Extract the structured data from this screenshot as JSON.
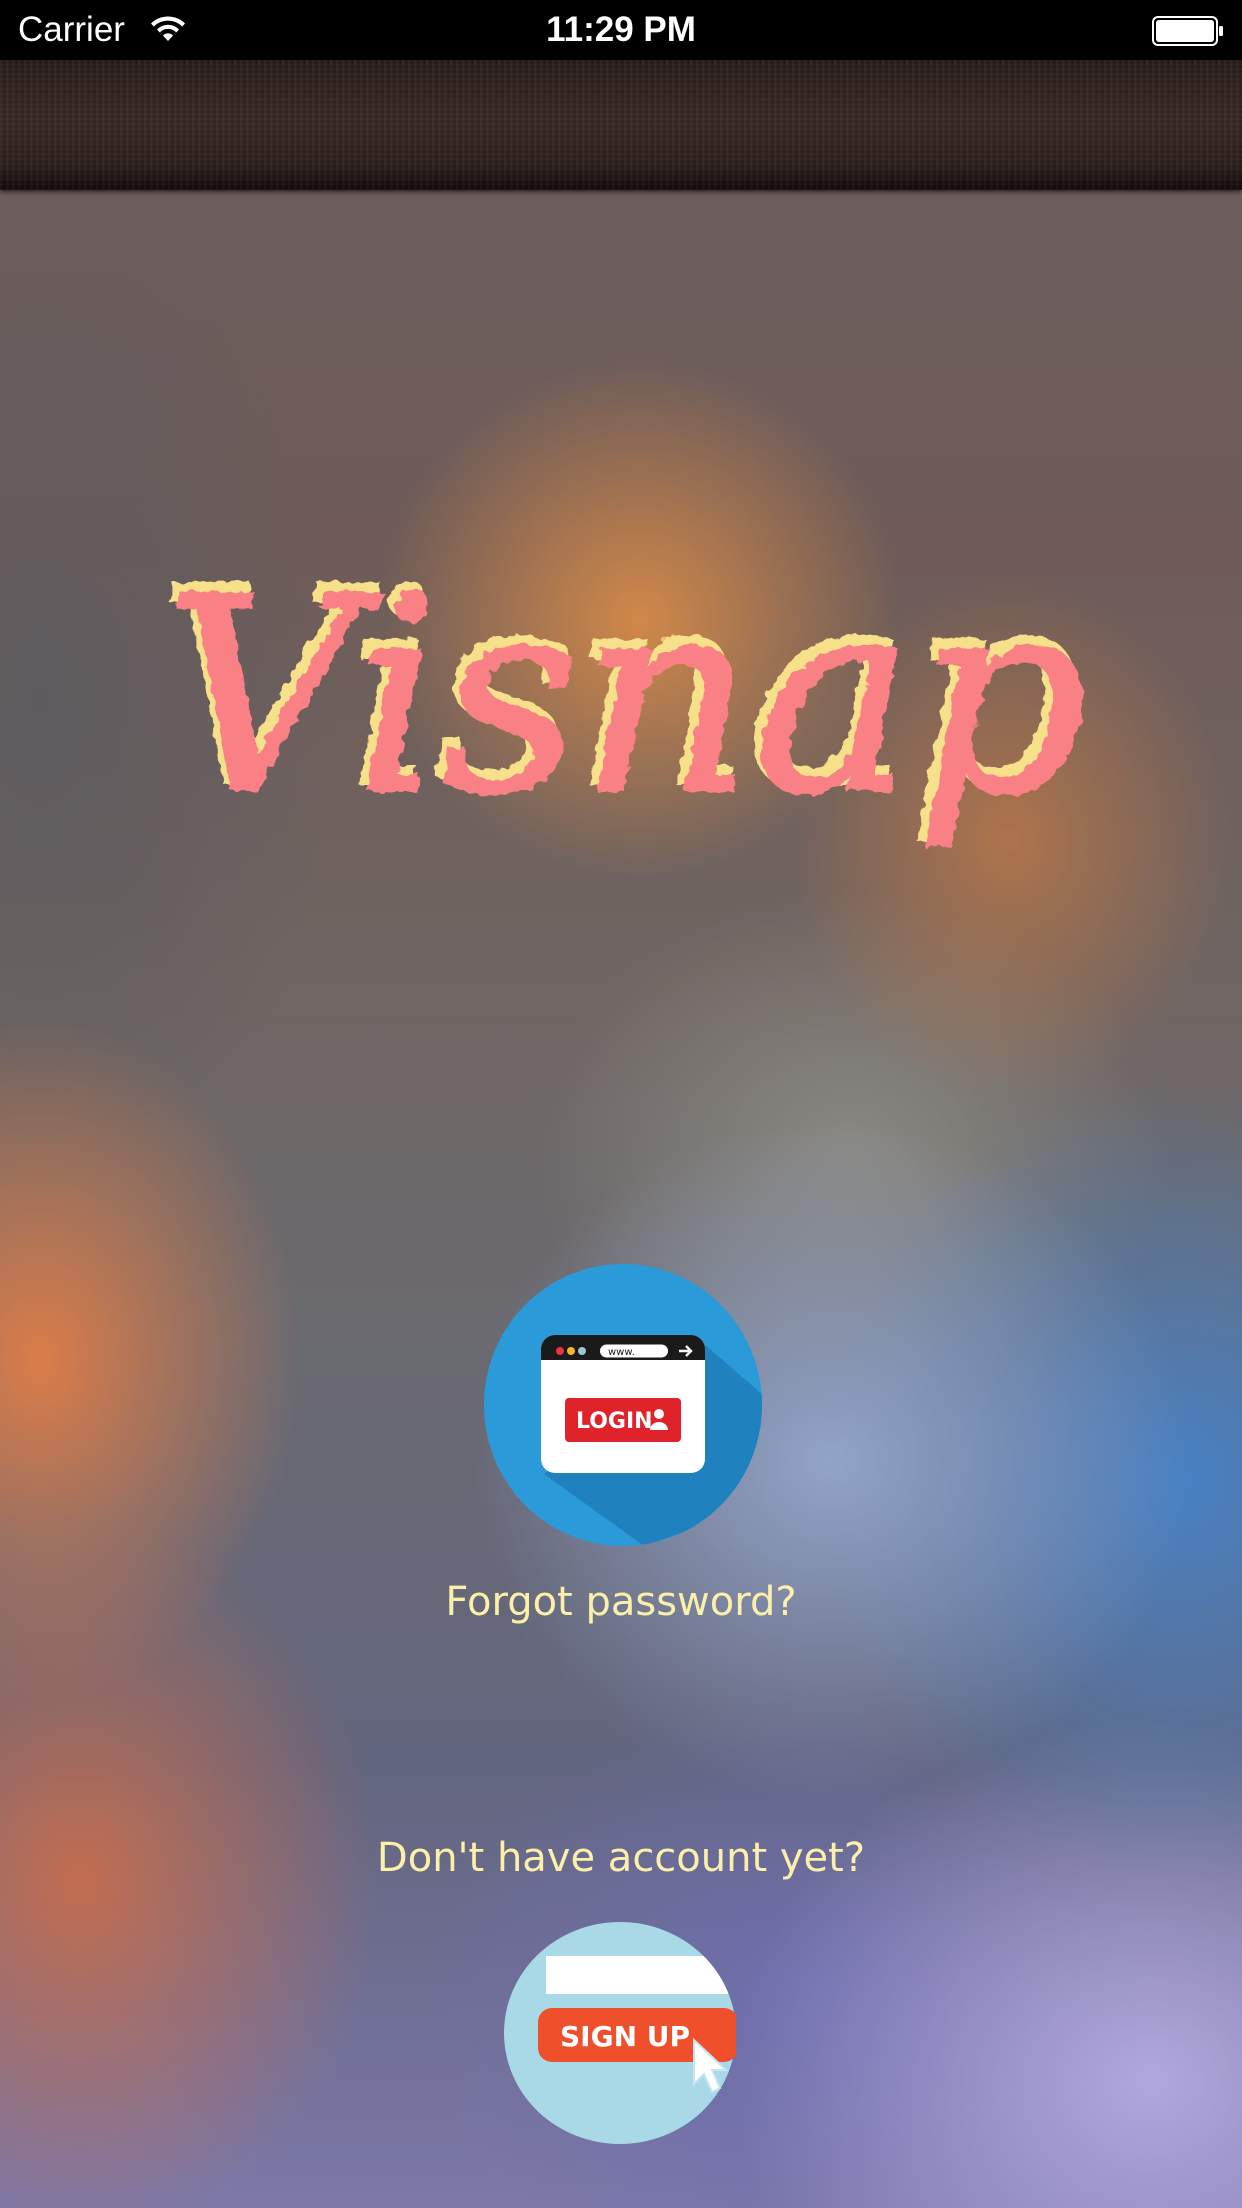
{
  "status_bar": {
    "carrier": "Carrier",
    "time": "11:29 PM",
    "wifi_icon": "wifi-icon",
    "battery_icon": "battery-full-icon"
  },
  "logo": {
    "text": "Visnap",
    "fill_color": "#f98085",
    "shadow_color": "#f7e08a"
  },
  "login": {
    "icon": "browser-login-icon",
    "url_text": "www.",
    "label": "LOGIN",
    "circle_color": "#2a9ad9",
    "button_color": "#e0232b"
  },
  "forgot_password": {
    "label": "Forgot password?"
  },
  "signup_prompt": {
    "label": "Don't have account yet?"
  },
  "signup": {
    "icon": "signup-cursor-icon",
    "label": "SIGN UP",
    "circle_color": "#a9d8e6",
    "button_color": "#f04f2c"
  },
  "text_color": "#fbefaa"
}
